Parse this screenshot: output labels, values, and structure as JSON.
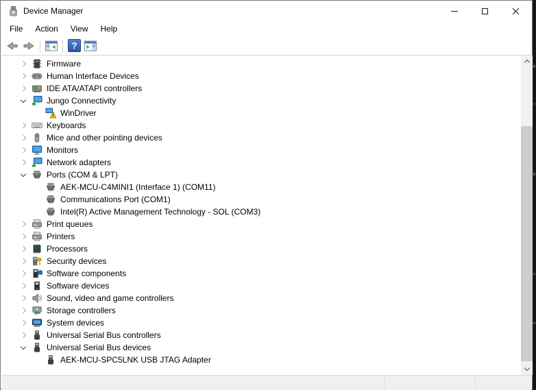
{
  "window": {
    "title": "Device Manager",
    "app_icon": "device-manager-icon",
    "controls": [
      {
        "name": "minimize"
      },
      {
        "name": "maximize"
      },
      {
        "name": "close"
      }
    ]
  },
  "menu": {
    "items": [
      {
        "label": "File"
      },
      {
        "label": "Action"
      },
      {
        "label": "View"
      },
      {
        "label": "Help"
      }
    ]
  },
  "toolbar": {
    "buttons": [
      {
        "name": "back",
        "icon": "back-arrow-icon"
      },
      {
        "name": "forward",
        "icon": "forward-arrow-icon"
      },
      {
        "name": "separator"
      },
      {
        "name": "show-console-tree",
        "icon": "console-tree-icon"
      },
      {
        "name": "separator"
      },
      {
        "name": "help",
        "icon": "help-icon"
      },
      {
        "name": "properties",
        "icon": "properties-window-icon"
      }
    ]
  },
  "tree": {
    "items": [
      {
        "label": "Firmware",
        "level": 0,
        "state": "collapsed",
        "icon": "firmware-chip"
      },
      {
        "label": "Human Interface Devices",
        "level": 0,
        "state": "collapsed",
        "icon": "hid-gamepad"
      },
      {
        "label": "IDE ATA/ATAPI controllers",
        "level": 0,
        "state": "collapsed",
        "icon": "ide-controller"
      },
      {
        "label": "Jungo Connectivity",
        "level": 0,
        "state": "expanded",
        "icon": "network-monitor"
      },
      {
        "label": "WinDriver",
        "level": 1,
        "state": "leaf",
        "icon": "device-warning"
      },
      {
        "label": "Keyboards",
        "level": 0,
        "state": "collapsed",
        "icon": "keyboard"
      },
      {
        "label": "Mice and other pointing devices",
        "level": 0,
        "state": "collapsed",
        "icon": "mouse"
      },
      {
        "label": "Monitors",
        "level": 0,
        "state": "collapsed",
        "icon": "monitor"
      },
      {
        "label": "Network adapters",
        "level": 0,
        "state": "collapsed",
        "icon": "network-monitor"
      },
      {
        "label": "Ports (COM & LPT)",
        "level": 0,
        "state": "expanded",
        "icon": "serial-port"
      },
      {
        "label": "AEK-MCU-C4MINI1 (Interface 1) (COM11)",
        "level": 1,
        "state": "leaf",
        "icon": "serial-port"
      },
      {
        "label": "Communications Port (COM1)",
        "level": 1,
        "state": "leaf",
        "icon": "serial-port"
      },
      {
        "label": "Intel(R) Active Management Technology - SOL (COM3)",
        "level": 1,
        "state": "leaf",
        "icon": "serial-port"
      },
      {
        "label": "Print queues",
        "level": 0,
        "state": "collapsed",
        "icon": "printer"
      },
      {
        "label": "Printers",
        "level": 0,
        "state": "collapsed",
        "icon": "printer"
      },
      {
        "label": "Processors",
        "level": 0,
        "state": "collapsed",
        "icon": "processor-chip"
      },
      {
        "label": "Security devices",
        "level": 0,
        "state": "collapsed",
        "icon": "security-key"
      },
      {
        "label": "Software components",
        "level": 0,
        "state": "collapsed",
        "icon": "software-component"
      },
      {
        "label": "Software devices",
        "level": 0,
        "state": "collapsed",
        "icon": "software-device"
      },
      {
        "label": "Sound, video and game controllers",
        "level": 0,
        "state": "collapsed",
        "icon": "speaker"
      },
      {
        "label": "Storage controllers",
        "level": 0,
        "state": "collapsed",
        "icon": "storage-controller"
      },
      {
        "label": "System devices",
        "level": 0,
        "state": "collapsed",
        "icon": "system-device"
      },
      {
        "label": "Universal Serial Bus controllers",
        "level": 0,
        "state": "collapsed",
        "icon": "usb-plug"
      },
      {
        "label": "Universal Serial Bus devices",
        "level": 0,
        "state": "expanded",
        "icon": "usb-plug"
      },
      {
        "label": "AEK-MCU-SPC5LNK USB JTAG Adapter",
        "level": 1,
        "state": "leaf",
        "icon": "usb-plug"
      }
    ]
  },
  "colors": {
    "help_blue": "#2d64c8",
    "warning_yellow": "#fccf1e",
    "icon_green": "#2fa646",
    "monitor_blue": "#4da6e8",
    "scroll_track": "#f0f0f0",
    "scroll_thumb": "#cdcdcd"
  }
}
